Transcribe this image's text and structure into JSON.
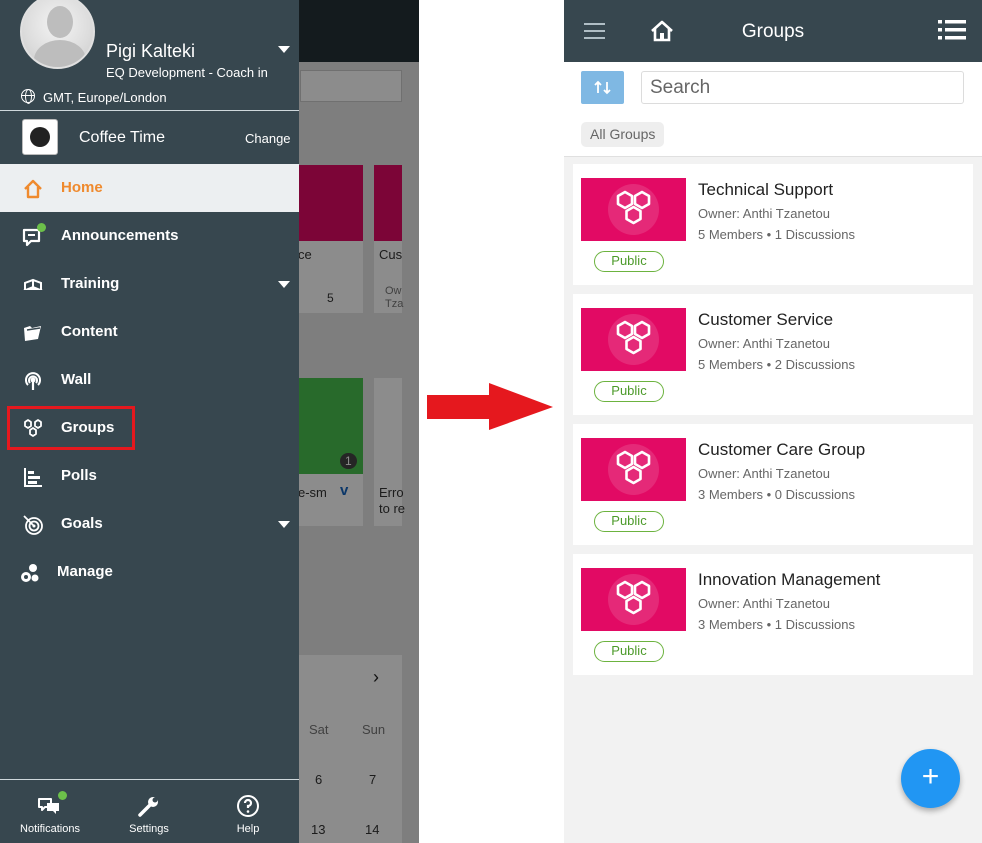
{
  "left": {
    "user": {
      "name": "Pigi Kalteki",
      "role": "EQ Development - Coach in",
      "timezone": "GMT, Europe/London"
    },
    "workspace": {
      "name": "Coffee Time",
      "change_label": "Change",
      "logo_text": "Coffee Time"
    },
    "menu": [
      {
        "label": "Home",
        "icon": "home-icon",
        "active": true
      },
      {
        "label": "Announcements",
        "icon": "announcement-icon",
        "badge": true
      },
      {
        "label": "Training",
        "icon": "training-icon",
        "expandable": true
      },
      {
        "label": "Content",
        "icon": "content-icon"
      },
      {
        "label": "Wall",
        "icon": "wall-icon"
      },
      {
        "label": "Groups",
        "icon": "groups-icon",
        "highlighted": true
      },
      {
        "label": "Polls",
        "icon": "polls-icon"
      },
      {
        "label": "Goals",
        "icon": "goals-icon",
        "expandable": true
      },
      {
        "label": "Manage",
        "icon": "manage-icon"
      }
    ],
    "bottom_nav": [
      {
        "label": "Notifications",
        "icon": "notifications-icon"
      },
      {
        "label": "Settings",
        "icon": "wrench-icon"
      },
      {
        "label": "Help",
        "icon": "help-icon"
      }
    ],
    "background": {
      "card1_text": "ce",
      "card1_count": "5",
      "card2_text": "Cus",
      "card2_sub1": "Ow",
      "card2_sub2": "Tza",
      "card3_text": "e-sm",
      "card3_views": "1",
      "card4_text": "Erro",
      "card4_sub": "to re",
      "calendar_days": [
        "Sat",
        "Sun"
      ],
      "calendar_row1": [
        "6",
        "7"
      ],
      "calendar_row2": [
        "13",
        "14"
      ]
    }
  },
  "right": {
    "title": "Groups",
    "search": {
      "placeholder": "Search"
    },
    "filter_chip": "All Groups",
    "groups": [
      {
        "name": "Technical Support",
        "owner": "Owner: Anthi Tzanetou",
        "stats": "5 Members • 1 Discussions",
        "visibility": "Public"
      },
      {
        "name": "Customer Service",
        "owner": "Owner: Anthi Tzanetou",
        "stats": "5 Members • 2 Discussions",
        "visibility": "Public"
      },
      {
        "name": "Customer Care Group",
        "owner": "Owner: Anthi Tzanetou",
        "stats": "3 Members • 0 Discussions",
        "visibility": "Public"
      },
      {
        "name": "Innovation Management",
        "owner": "Owner: Anthi Tzanetou",
        "stats": "3 Members • 1 Discussions",
        "visibility": "Public"
      }
    ],
    "fab_label": "+"
  },
  "colors": {
    "drawer": "#37474f",
    "active_text": "#ef8a2e",
    "group_thumb": "#e20a64",
    "public_pill": "#6cb33f",
    "fab": "#2196f3",
    "highlight": "#e5181e",
    "arrow": "#e5181e"
  }
}
